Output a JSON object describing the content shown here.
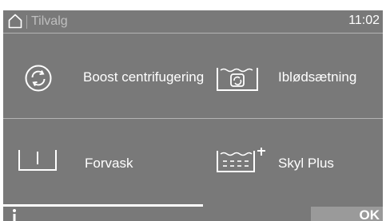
{
  "header": {
    "home_icon": "home-icon",
    "title": "Tilvalg",
    "time": "11:02"
  },
  "options": [
    {
      "icon": "boost-spin-icon",
      "label": "Boost centrifugering"
    },
    {
      "icon": "soak-icon",
      "label": "Iblødsætning"
    },
    {
      "icon": "prewash-icon",
      "label": "Forvask"
    },
    {
      "icon": "rinse-plus-icon",
      "label": "Skyl Plus"
    }
  ],
  "footer": {
    "info_icon": "info-icon",
    "ok_label": "OK"
  },
  "colors": {
    "screen_bg": "#797979",
    "divider": "#b4b4b4",
    "ok_bg": "#9a9a9a"
  }
}
